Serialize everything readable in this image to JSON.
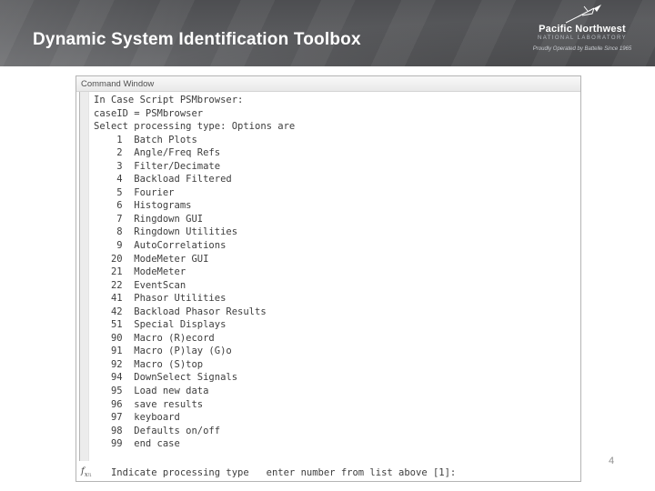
{
  "slide": {
    "title": "Dynamic System Identification Toolbox",
    "page_number": "4"
  },
  "logo": {
    "name": "Pacific Northwest",
    "subtitle": "NATIONAL LABORATORY",
    "tagline": "Proudly Operated by Battelle Since 1965"
  },
  "command_window": {
    "title": "Command Window",
    "lines": [
      "In Case Script PSMbrowser:",
      "caseID = PSMbrowser",
      "Select processing type: Options are",
      "    1  Batch Plots",
      "    2  Angle/Freq Refs",
      "    3  Filter/Decimate",
      "    4  Backload Filtered",
      "    5  Fourier",
      "    6  Histograms",
      "    7  Ringdown GUI",
      "    8  Ringdown Utilities",
      "    9  AutoCorrelations",
      "   20  ModeMeter GUI",
      "   21  ModeMeter",
      "   22  EventScan",
      "   41  Phasor Utilities",
      "   42  Backload Phasor Results",
      "   51  Special Displays",
      "   90  Macro (R)ecord",
      "   91  Macro (P)lay (G)o",
      "   92  Macro (S)top",
      "   94  DownSelect Signals",
      "   95  Load new data",
      "   96  save results",
      "   97  keyboard",
      "   98  Defaults on/off",
      "   99  end case"
    ],
    "prompt_icon_f": "f",
    "prompt_icon_x": "x",
    "prompt": "   Indicate processing type   enter number from list above [1]:"
  },
  "colors": {
    "header_dark": "#3f4045",
    "header_mid": "#646568",
    "title_text": "#ffffff",
    "console_text": "#3d3d3d",
    "window_border": "#b4b4b4"
  }
}
